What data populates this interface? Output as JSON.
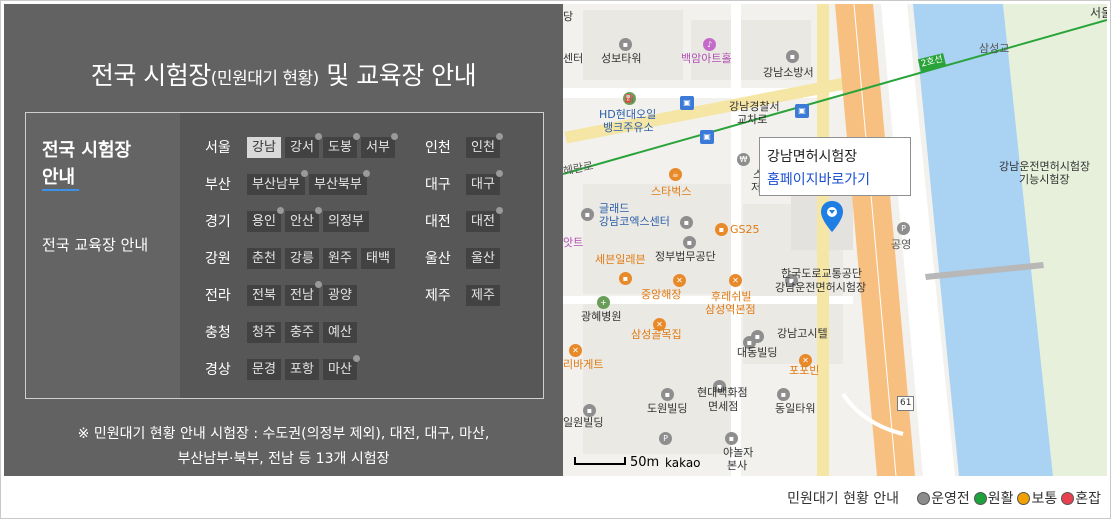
{
  "panel": {
    "title_main": "전국 시험장",
    "title_sub": "(민원대기 현황)",
    "title_tail": " 및 교육장 안내",
    "menu_exam": "전국 시험장 안내",
    "menu_edu": "전국 교육장 안내",
    "note_line1": "※ 민원대기 현황 안내 시험장 : 수도권(의정부 제외), 대전, 대구, 마산,",
    "note_line2": "부산남부·북부, 전남 등 13개 시험장"
  },
  "regions": {
    "seoul": {
      "name": "서울",
      "sites": [
        "강남",
        "강서",
        "도봉",
        "서부"
      ]
    },
    "busan": {
      "name": "부산",
      "sites": [
        "부산남부",
        "부산북부"
      ]
    },
    "gyeonggi": {
      "name": "경기",
      "sites": [
        "용인",
        "안산",
        "의정부"
      ]
    },
    "gangwon": {
      "name": "강원",
      "sites": [
        "춘천",
        "강릉",
        "원주",
        "태백"
      ]
    },
    "jeolla": {
      "name": "전라",
      "sites": [
        "전북",
        "전남",
        "광양"
      ]
    },
    "chungcheong": {
      "name": "충청",
      "sites": [
        "청주",
        "충주",
        "예산"
      ]
    },
    "gyeongsang": {
      "name": "경상",
      "sites": [
        "문경",
        "포항",
        "마산"
      ]
    },
    "incheon": {
      "name": "인천",
      "sites": [
        "인천"
      ]
    },
    "daegu": {
      "name": "대구",
      "sites": [
        "대구"
      ]
    },
    "daejeon": {
      "name": "대전",
      "sites": [
        "대전"
      ]
    },
    "ulsan": {
      "name": "울산",
      "sites": [
        "울산"
      ]
    },
    "jeju": {
      "name": "제주",
      "sites": [
        "제주"
      ]
    }
  },
  "map": {
    "info_title": "강남면허시험장",
    "info_link": "홈페이지바로가기",
    "scale": "50m",
    "attribution": "kakao",
    "labels": {
      "dang": "당",
      "seoul_edge": "서울",
      "center": "센터",
      "seongbo": "성보타워",
      "baekam": "백암아트홀",
      "fire": "강남소방서",
      "samseong": "삼성교",
      "line2": "2호선",
      "hd1": "HD현대오일",
      "hd2": "뱅크주유소",
      "police1": "강남경찰서",
      "police2": "교차로",
      "haeran": "헤란로",
      "smart1": "스마트",
      "smart2": "저축은",
      "starbucks": "스타벅스",
      "glad1": "글래드",
      "glad2": "강남코엑스센터",
      "gs25": "GS25",
      "gongyeong": "공영",
      "driver1": "강남운전면허시험장",
      "driver2": "기능시험장",
      "at": "앗트",
      "court": "정부법무공단",
      "seven": "세븐일레븐",
      "kts1": "한국도로교통공단",
      "kts2": "강남운전면허시험장",
      "jungang": "중앙해장",
      "hure1": "후레쉬빌",
      "hure2": "삼성역본점",
      "hospital": "광혜병원",
      "gosi": "강남고시텔",
      "samseonggol": "삼성골목집",
      "daedong": "대동빌딩",
      "bamarket": "리바게트",
      "popobin": "포포빈",
      "hyundai1": "현대백화점",
      "hyundai2": "면세점",
      "dowon": "도원빌딩",
      "dongil": "동일타워",
      "road61": "61",
      "ilwon": "일원빌딩",
      "yanolja1": "야놀자",
      "yanolja2": "본사"
    }
  },
  "legend": {
    "title": "민원대기 현황 안내",
    "items": [
      {
        "label": "운영전",
        "color": "#8c8c8c"
      },
      {
        "label": "원활",
        "color": "#1fa13c"
      },
      {
        "label": "보통",
        "color": "#f0a000"
      },
      {
        "label": "혼잡",
        "color": "#e8414f"
      }
    ]
  },
  "colors": {
    "panel_bg": "#626262",
    "accent_underline": "#3e92e6",
    "link": "#1a4fd1",
    "river": "#a9d2f3",
    "highway": "#f7bf80",
    "metro_line2": "#2aa33b"
  }
}
